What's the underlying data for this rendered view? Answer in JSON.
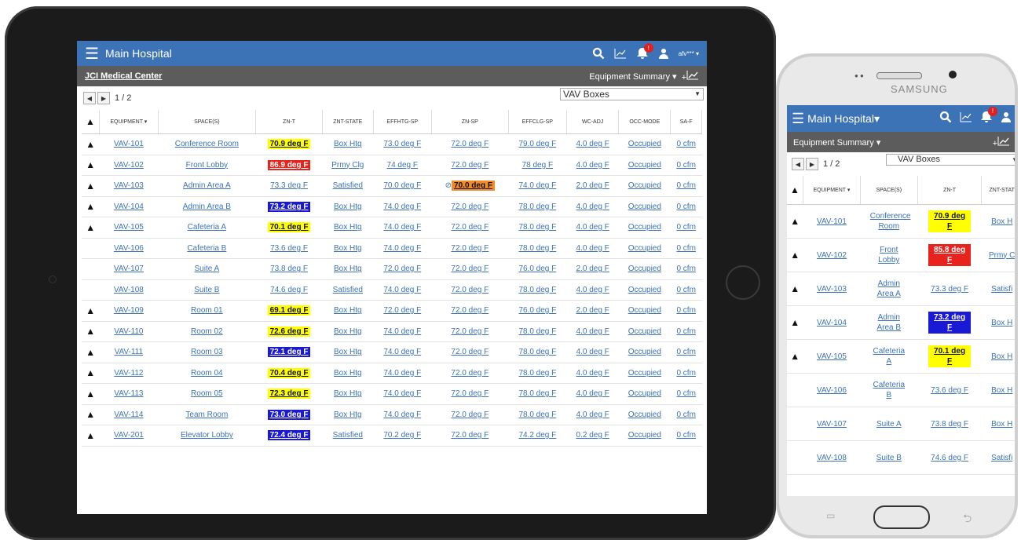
{
  "tablet": {
    "app_title": "Main Hospital",
    "user": "afv***",
    "notif_count": "!",
    "breadcrumb": "JCI Medical Center",
    "view_menu": "Equipment Summary",
    "trend_plus": "+",
    "page_indicator": "1 / 2",
    "equipment_type": "VAV Boxes",
    "columns": [
      "EQUIPMENT",
      "SPACE(S)",
      "ZN-T",
      "ZNT-STATE",
      "EFFHTG-SP",
      "ZN-SP",
      "EFFCLG-SP",
      "WC-ADJ",
      "OCC-MODE",
      "SA-F"
    ],
    "rows": [
      {
        "warn": true,
        "eq": "VAV-101",
        "space": "Conference Room",
        "znt": "70.9 deg F",
        "hl": "y",
        "state": "Box Htg",
        "htg": "73.0 deg F",
        "znsp": "72.0 deg F",
        "znsp_hl": "",
        "clg": "79.0 deg F",
        "wc": "4.0 deg F",
        "occ": "Occupied",
        "saf": "0 cfm"
      },
      {
        "warn": true,
        "eq": "VAV-102",
        "space": "Front Lobby",
        "znt": "86.9 deg F",
        "hl": "r",
        "state": "Prmy Clg",
        "htg": "74 deg F",
        "znsp": "72.0 deg F",
        "znsp_hl": "",
        "clg": "78 deg F",
        "wc": "4.0 deg F",
        "occ": "Occupied",
        "saf": "0 cfm"
      },
      {
        "warn": true,
        "eq": "VAV-103",
        "space": "Admin Area A",
        "znt": "73.3 deg F",
        "hl": "",
        "state": "Satisfied",
        "htg": "70.0 deg F",
        "znsp": "70.0 deg F",
        "znsp_hl": "o",
        "clg": "74.0 deg F",
        "wc": "2.0 deg F",
        "occ": "Occupied",
        "saf": "0 cfm"
      },
      {
        "warn": true,
        "eq": "VAV-104",
        "space": "Admin Area B",
        "znt": "73.2 deg F",
        "hl": "b",
        "state": "Box Htg",
        "htg": "74.0 deg F",
        "znsp": "72.0 deg F",
        "znsp_hl": "",
        "clg": "78.0 deg F",
        "wc": "4.0 deg F",
        "occ": "Occupied",
        "saf": "0 cfm"
      },
      {
        "warn": true,
        "eq": "VAV-105",
        "space": "Cafeteria A",
        "znt": "70.1 deg F",
        "hl": "y",
        "state": "Box Htg",
        "htg": "74.0 deg F",
        "znsp": "72.0 deg F",
        "znsp_hl": "",
        "clg": "78.0 deg F",
        "wc": "4.0 deg F",
        "occ": "Occupied",
        "saf": "0 cfm"
      },
      {
        "warn": false,
        "eq": "VAV-106",
        "space": "Cafeteria B",
        "znt": "73.6 deg F",
        "hl": "",
        "state": "Box Htg",
        "htg": "74.0 deg F",
        "znsp": "72.0 deg F",
        "znsp_hl": "",
        "clg": "78.0 deg F",
        "wc": "4.0 deg F",
        "occ": "Occupied",
        "saf": "0 cfm"
      },
      {
        "warn": false,
        "eq": "VAV-107",
        "space": "Suite A",
        "znt": "73.8 deg F",
        "hl": "",
        "state": "Box Htg",
        "htg": "72.0 deg F",
        "znsp": "72.0 deg F",
        "znsp_hl": "",
        "clg": "76.0 deg F",
        "wc": "2.0 deg F",
        "occ": "Occupied",
        "saf": "0 cfm"
      },
      {
        "warn": false,
        "eq": "VAV-108",
        "space": "Suite B",
        "znt": "74.6 deg F",
        "hl": "",
        "state": "Satisfied",
        "htg": "74.0 deg F",
        "znsp": "72.0 deg F",
        "znsp_hl": "",
        "clg": "78.0 deg F",
        "wc": "4.0 deg F",
        "occ": "Occupied",
        "saf": "0 cfm"
      },
      {
        "warn": true,
        "eq": "VAV-109",
        "space": "Room 01",
        "znt": "69.1 deg F",
        "hl": "y",
        "state": "Box Htg",
        "htg": "72.0 deg F",
        "znsp": "72.0 deg F",
        "znsp_hl": "",
        "clg": "76.0 deg F",
        "wc": "2.0 deg F",
        "occ": "Occupied",
        "saf": "0 cfm"
      },
      {
        "warn": true,
        "eq": "VAV-110",
        "space": "Room 02",
        "znt": "72.6 deg F",
        "hl": "y",
        "state": "Box Htg",
        "htg": "74.0 deg F",
        "znsp": "72.0 deg F",
        "znsp_hl": "",
        "clg": "78.0 deg F",
        "wc": "4.0 deg F",
        "occ": "Occupied",
        "saf": "0 cfm"
      },
      {
        "warn": true,
        "eq": "VAV-111",
        "space": "Room 03",
        "znt": "72.1 deg F",
        "hl": "b",
        "state": "Box Htg",
        "htg": "74.0 deg F",
        "znsp": "72.0 deg F",
        "znsp_hl": "",
        "clg": "78.0 deg F",
        "wc": "4.0 deg F",
        "occ": "Occupied",
        "saf": "0 cfm"
      },
      {
        "warn": true,
        "eq": "VAV-112",
        "space": "Room 04",
        "znt": "70.4 deg F",
        "hl": "y",
        "state": "Box Htg",
        "htg": "74.0 deg F",
        "znsp": "72.0 deg F",
        "znsp_hl": "",
        "clg": "78.0 deg F",
        "wc": "4.0 deg F",
        "occ": "Occupied",
        "saf": "0 cfm"
      },
      {
        "warn": true,
        "eq": "VAV-113",
        "space": "Room 05",
        "znt": "72.3 deg F",
        "hl": "y",
        "state": "Box Htg",
        "htg": "74.0 deg F",
        "znsp": "72.0 deg F",
        "znsp_hl": "",
        "clg": "78.0 deg F",
        "wc": "4.0 deg F",
        "occ": "Occupied",
        "saf": "0 cfm"
      },
      {
        "warn": true,
        "eq": "VAV-114",
        "space": "Team Room",
        "znt": "73.0 deg F",
        "hl": "b",
        "state": "Box Htg",
        "htg": "74.0 deg F",
        "znsp": "72.0 deg F",
        "znsp_hl": "",
        "clg": "78.0 deg F",
        "wc": "4.0 deg F",
        "occ": "Occupied",
        "saf": "0 cfm"
      },
      {
        "warn": true,
        "eq": "VAV-201",
        "space": "Elevator Lobby",
        "znt": "72.4 deg F",
        "hl": "b",
        "state": "Satisfied",
        "htg": "70.2 deg F",
        "znsp": "72.0 deg F",
        "znsp_hl": "",
        "clg": "74.2 deg F",
        "wc": "0.2 deg F",
        "occ": "Occupied",
        "saf": "0 cfm"
      }
    ]
  },
  "phone": {
    "brand": "SAMSUNG",
    "app_title": "Main Hospital",
    "view_menu": "Equipment Summary",
    "trend_plus": "+",
    "page_indicator": "1 / 2",
    "equipment_type": "VAV Boxes",
    "columns": [
      "EQUIPMENT",
      "SPACE(S)",
      "ZN-T",
      "ZNT-STAT"
    ],
    "rows": [
      {
        "warn": true,
        "eq": "VAV-101",
        "space": "Conference Room",
        "znt": "70.9 deg F",
        "hl": "y",
        "state": "Box H"
      },
      {
        "warn": true,
        "eq": "VAV-102",
        "space": "Front Lobby",
        "znt": "85.8 deg F",
        "hl": "r",
        "state": "Prmy C"
      },
      {
        "warn": true,
        "eq": "VAV-103",
        "space": "Admin Area A",
        "znt": "73.3 deg F",
        "hl": "",
        "state": "Satisfi"
      },
      {
        "warn": true,
        "eq": "VAV-104",
        "space": "Admin Area B",
        "znt": "73.2 deg F",
        "hl": "b",
        "state": "Box H"
      },
      {
        "warn": true,
        "eq": "VAV-105",
        "space": "Cafeteria A",
        "znt": "70.1 deg F",
        "hl": "y",
        "state": "Box H"
      },
      {
        "warn": false,
        "eq": "VAV-106",
        "space": "Cafeteria B",
        "znt": "73.6 deg F",
        "hl": "",
        "state": "Box H"
      },
      {
        "warn": false,
        "eq": "VAV-107",
        "space": "Suite A",
        "znt": "73.8 deg F",
        "hl": "",
        "state": "Box H"
      },
      {
        "warn": false,
        "eq": "VAV-108",
        "space": "Suite B",
        "znt": "74.6 deg F",
        "hl": "",
        "state": "Satisfi"
      }
    ]
  },
  "colors": {
    "header_blue": "#3c73b6",
    "subheader_gray": "#5c5c5c",
    "alarm_yellow": "#ffff00",
    "alarm_red": "#e8231d",
    "alarm_blue": "#1a1ad6",
    "alarm_orange": "#f28c28"
  },
  "icons": [
    "hamburger-menu-icon",
    "search-icon",
    "trend-chart-icon",
    "bell-icon",
    "user-icon",
    "warning-triangle-icon"
  ]
}
